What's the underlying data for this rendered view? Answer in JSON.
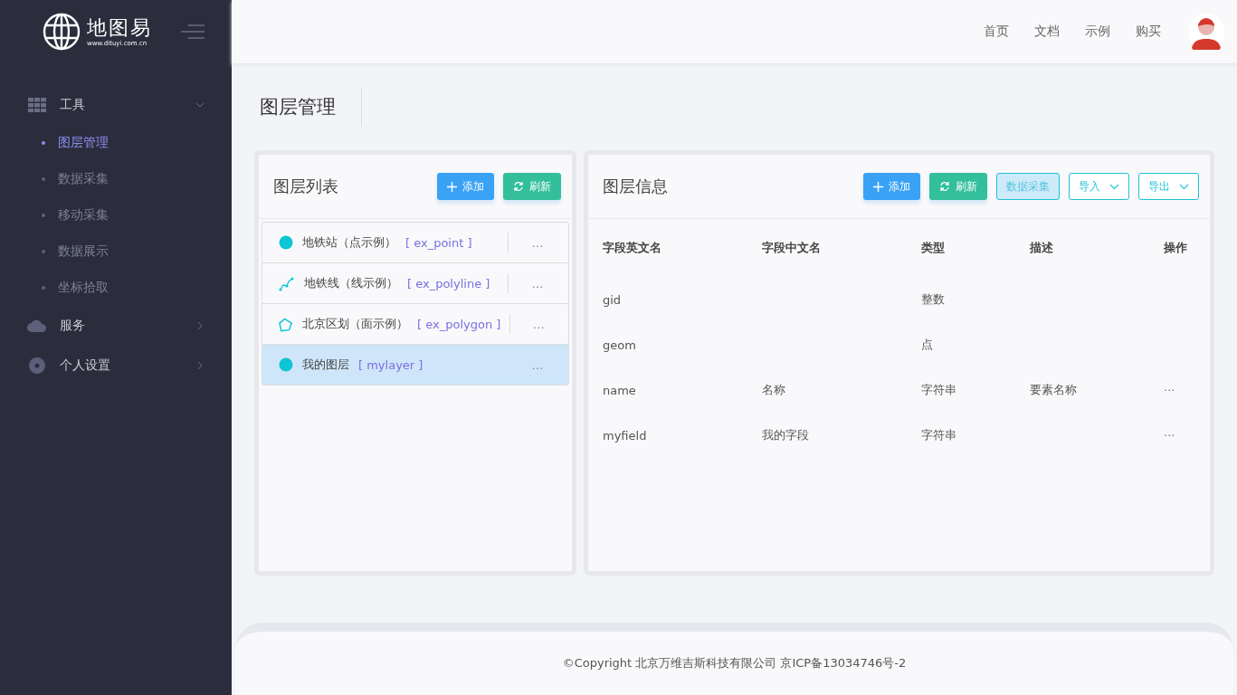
{
  "logo": {
    "name": "地图易",
    "url": "www.dituyi.com.cn"
  },
  "sidebar": {
    "items": [
      {
        "label": "工具",
        "kind": "grid",
        "expanded": true,
        "children": [
          {
            "label": "图层管理",
            "selected": true
          },
          {
            "label": "数据采集",
            "selected": false
          },
          {
            "label": "移动采集",
            "selected": false
          },
          {
            "label": "数据展示",
            "selected": false
          },
          {
            "label": "坐标拾取",
            "selected": false
          }
        ]
      },
      {
        "label": "服务",
        "kind": "cloud",
        "expanded": false
      },
      {
        "label": "个人设置",
        "kind": "gear",
        "expanded": false
      }
    ]
  },
  "top_nav": [
    "首页",
    "文档",
    "示例",
    "购买"
  ],
  "page_title": "图层管理",
  "layer_panel": {
    "title": "图层列表",
    "buttons": [
      {
        "label": "添加",
        "kind": "add"
      },
      {
        "label": "刷新",
        "kind": "refresh"
      }
    ],
    "layers": [
      {
        "name": "地铁站（点示例）",
        "code": "[ ex_point ]",
        "kind": "point",
        "selected": false,
        "more": "…"
      },
      {
        "name": "地铁线（线示例）",
        "code": "[ ex_polyline ]",
        "kind": "polyline",
        "selected": false,
        "more": "…"
      },
      {
        "name": "北京区划（面示例）",
        "code": "[ ex_polygon ]",
        "kind": "polygon",
        "selected": false,
        "more": "…"
      },
      {
        "name": "我的图层",
        "code": "[ mylayer ]",
        "kind": "point",
        "selected": true,
        "more": "…"
      }
    ]
  },
  "info_panel": {
    "title": "图层信息",
    "buttons": [
      {
        "label": "添加",
        "kind": "add"
      },
      {
        "label": "刷新",
        "kind": "refresh"
      },
      {
        "label": "数据采集",
        "kind": "hover"
      },
      {
        "label": "导入",
        "kind": "dropdown"
      },
      {
        "label": "导出",
        "kind": "dropdown"
      }
    ],
    "table": {
      "columns": [
        "字段英文名",
        "字段中文名",
        "类型",
        "描述",
        "操作"
      ],
      "rows": [
        {
          "cells": [
            "gid",
            "",
            "整数",
            ""
          ],
          "actions": ""
        },
        {
          "cells": [
            "geom",
            "",
            "点",
            ""
          ],
          "actions": ""
        },
        {
          "cells": [
            "name",
            "名称",
            "字符串",
            "要素名称"
          ],
          "actions": "···"
        },
        {
          "cells": [
            "myfield",
            "我的字段",
            "字符串",
            ""
          ],
          "actions": "···"
        }
      ]
    }
  },
  "footer": "©Copyright 北京万维吉斯科技有限公司 京ICP备13034746号-2"
}
